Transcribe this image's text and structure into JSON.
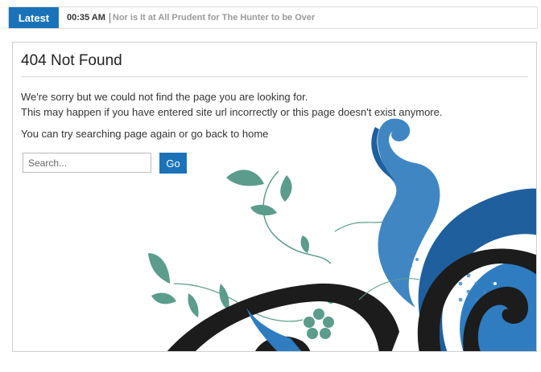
{
  "ticker": {
    "label": "Latest",
    "time": "00:35 AM",
    "headline": "Nor is It at All Prudent for The Hunter to be Over"
  },
  "error": {
    "title": "404 Not Found",
    "line1": "We're sorry but we could not find the page you are looking for.",
    "line2": "This may happen if you have entered site url incorrectly or this page doesn't exist anymore.",
    "line3": "You can try searching page again or go back to home"
  },
  "search": {
    "placeholder": "Search...",
    "button_label": "Go"
  },
  "colors": {
    "accent": "#1a73b9",
    "swirl_blue": "#1f5f9e",
    "swirl_light": "#3f86c3",
    "leaf": "#5c9c8c",
    "swirl_dark": "#1c1c1c"
  }
}
